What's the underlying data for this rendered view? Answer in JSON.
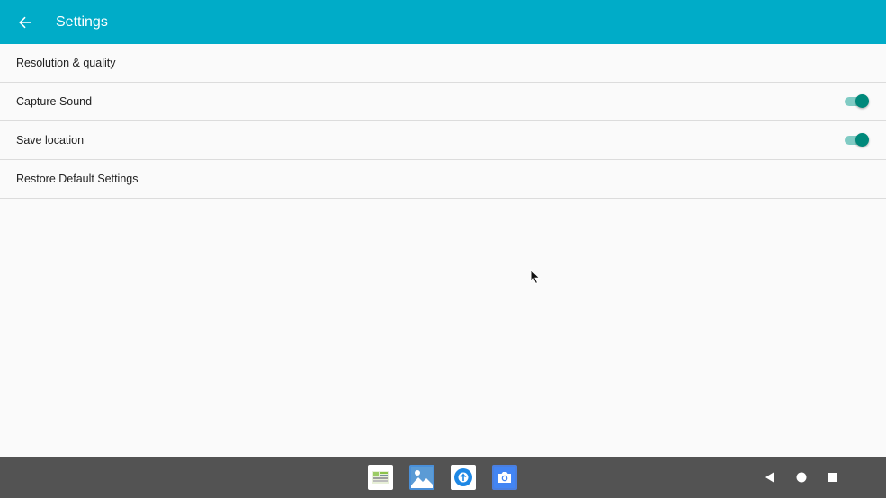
{
  "app_bar": {
    "title": "Settings",
    "back_icon": "arrow-back-icon",
    "color": "#00acc8"
  },
  "settings": [
    {
      "label": "Resolution & quality",
      "has_toggle": false
    },
    {
      "label": "Capture Sound",
      "has_toggle": true,
      "toggle_on": true
    },
    {
      "label": "Save location",
      "has_toggle": true,
      "toggle_on": true
    },
    {
      "label": "Restore Default Settings",
      "has_toggle": false
    }
  ],
  "taskbar": {
    "apps": [
      {
        "name": "gallery-widget-icon"
      },
      {
        "name": "photos-icon"
      },
      {
        "name": "app-compass-icon"
      },
      {
        "name": "camera-icon"
      }
    ],
    "nav": [
      "back-triangle-icon",
      "home-circle-icon",
      "recents-square-icon"
    ],
    "color": "#535353"
  },
  "accent_color": "#00897b"
}
